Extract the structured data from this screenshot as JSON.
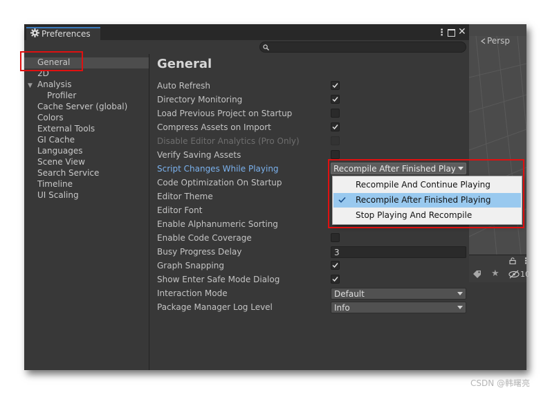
{
  "window": {
    "tab_title": "Preferences",
    "menu_icon": "more-dots-icon",
    "maximize_icon": "maximize-icon",
    "close_icon": "close-icon",
    "search_placeholder": ""
  },
  "sidebar": {
    "items": [
      {
        "label": "General",
        "selected": true
      },
      {
        "label": "2D"
      },
      {
        "label": "Analysis",
        "expanded": true
      },
      {
        "label": "Profiler",
        "child": true
      },
      {
        "label": "Cache Server (global)"
      },
      {
        "label": "Colors"
      },
      {
        "label": "External Tools"
      },
      {
        "label": "GI Cache"
      },
      {
        "label": "Languages"
      },
      {
        "label": "Scene View"
      },
      {
        "label": "Search Service"
      },
      {
        "label": "Timeline"
      },
      {
        "label": "UI Scaling"
      }
    ]
  },
  "content": {
    "title": "General",
    "prefs": [
      {
        "label": "Auto Refresh",
        "type": "checkbox",
        "checked": true
      },
      {
        "label": "Directory Monitoring",
        "type": "checkbox",
        "checked": true
      },
      {
        "label": "Load Previous Project on Startup",
        "type": "checkbox",
        "checked": false
      },
      {
        "label": "Compress Assets on Import",
        "type": "checkbox",
        "checked": true
      },
      {
        "label": "Disable Editor Analytics (Pro Only)",
        "type": "checkbox",
        "checked": false,
        "disabled": true
      },
      {
        "label": "Verify Saving Assets",
        "type": "checkbox",
        "checked": false
      },
      {
        "label": "Script Changes While Playing",
        "type": "dropdown",
        "value": "Recompile After Finished Playin"
      },
      {
        "label": "Code Optimization On Startup",
        "type": "dropdown"
      },
      {
        "label": "Editor Theme",
        "type": "dropdown"
      },
      {
        "label": "Editor Font",
        "type": "dropdown"
      },
      {
        "label": "Enable Alphanumeric Sorting",
        "type": "checkbox"
      },
      {
        "label": "Enable Code Coverage",
        "type": "checkbox",
        "checked": false
      },
      {
        "label": "Busy Progress Delay",
        "type": "number",
        "value": "3"
      },
      {
        "label": "Graph Snapping",
        "type": "checkbox",
        "checked": true
      },
      {
        "label": "Show Enter Safe Mode Dialog",
        "type": "checkbox",
        "checked": true
      },
      {
        "label": "Interaction Mode",
        "type": "dropdown",
        "value": "Default"
      },
      {
        "label": "Package Manager Log Level",
        "type": "dropdown",
        "value": "Info"
      }
    ]
  },
  "popup": {
    "options": [
      {
        "label": "Recompile And Continue Playing",
        "selected": false
      },
      {
        "label": "Recompile After Finished Playing",
        "selected": true
      },
      {
        "label": "Stop Playing And Recompile",
        "selected": false
      }
    ]
  },
  "background": {
    "scene_label": "Persp",
    "hierarchy_count": "10"
  },
  "watermark": "CSDN @韩曙亮",
  "colors": {
    "highlight": "#e01010",
    "link_blue": "#7bb2ee",
    "popup_selected": "#99c9ef",
    "tab_accent": "#3a79bb"
  }
}
